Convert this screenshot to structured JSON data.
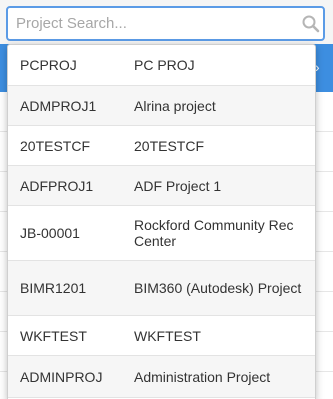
{
  "search": {
    "placeholder": "Project Search...",
    "value": ""
  },
  "projects": [
    {
      "code": "PCPROJ",
      "name": "PC PROJ"
    },
    {
      "code": "ADMPROJ1",
      "name": "Alrina project"
    },
    {
      "code": "20TESTCF",
      "name": "20TESTCF"
    },
    {
      "code": "ADFPROJ1",
      "name": "ADF Project 1"
    },
    {
      "code": "JB-00001",
      "name": "Rockford Community Rec Center"
    },
    {
      "code": "BIMR1201",
      "name": "BIM360 (Autodesk) Project"
    },
    {
      "code": "WKFTEST",
      "name": "WKFTEST"
    },
    {
      "code": "ADMINPROJ",
      "name": "Administration Project"
    }
  ],
  "colors": {
    "accent": "#5b9be6",
    "header_bar": "#3d8ee0"
  },
  "icons": {
    "search": "search-icon"
  }
}
